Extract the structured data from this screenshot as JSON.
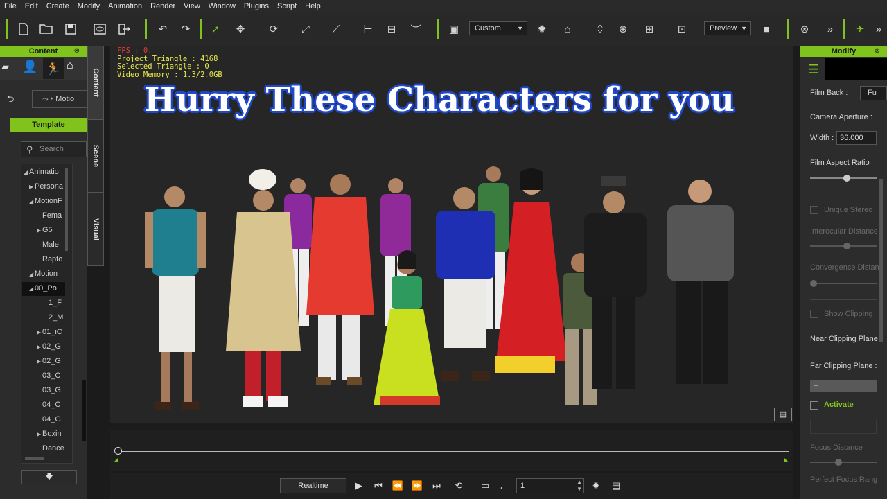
{
  "menu": [
    "File",
    "Edit",
    "Create",
    "Modify",
    "Animation",
    "Render",
    "View",
    "Window",
    "Plugins",
    "Script",
    "Help"
  ],
  "toolbar": {
    "preset_dropdown": "Custom",
    "preview_dropdown": "Preview",
    "overflow_label": "»"
  },
  "content_panel": {
    "title": "Content",
    "motion_button": "Motio",
    "template_tab": "Template",
    "search_placeholder": "Search",
    "tree": [
      "Animatio",
      "Persona",
      "MotionF",
      "Fema",
      "G5",
      "Male",
      "Rapto",
      "Motion",
      "00_Po",
      "1_F",
      "2_M",
      "01_iC",
      "02_G",
      "02_G",
      "03_C",
      "03_G",
      "04_C",
      "04_G",
      "Boxin",
      "Dance"
    ]
  },
  "side_tabs": [
    "Content",
    "Scene",
    "Visual"
  ],
  "viewport": {
    "stats": {
      "fps": "FPS : 0.",
      "project_triangle": "Project Triangle : 4168",
      "selected_triangle": "Selected Triangle : 0",
      "video_memory": "Video Memory : 1.3/2.0GB"
    },
    "headline": "Hurry These Characters for you"
  },
  "modify_panel": {
    "title": "Modify",
    "film_back_label": "Film Back :",
    "film_back_value": "Fu",
    "camera_aperture_label": "Camera Aperture :",
    "width_label": "Width :",
    "width_value": "36.000",
    "film_aspect_label": "Film Aspect Ratio",
    "unique_stereo_label": "Unique Stereo",
    "interocular_label": "Interocular Distance",
    "convergence_label": "Convergence Distan",
    "show_clipping_label": "Show Clipping",
    "near_clip_label": "Near Clipping Plane",
    "far_clip_label": "Far Clipping Plane :",
    "far_clip_value": "--",
    "activate_label": "Activate",
    "focus_distance_label": "Focus Distance",
    "perfect_focus_label": "Perfect Focus Rang"
  },
  "playback": {
    "realtime_label": "Realtime",
    "frame_value": "1"
  },
  "colors": {
    "accent": "#7fc31c",
    "headline_outline": "#1f49c9",
    "fps_text": "#e83a3a",
    "stat_text": "#e8e84a"
  }
}
